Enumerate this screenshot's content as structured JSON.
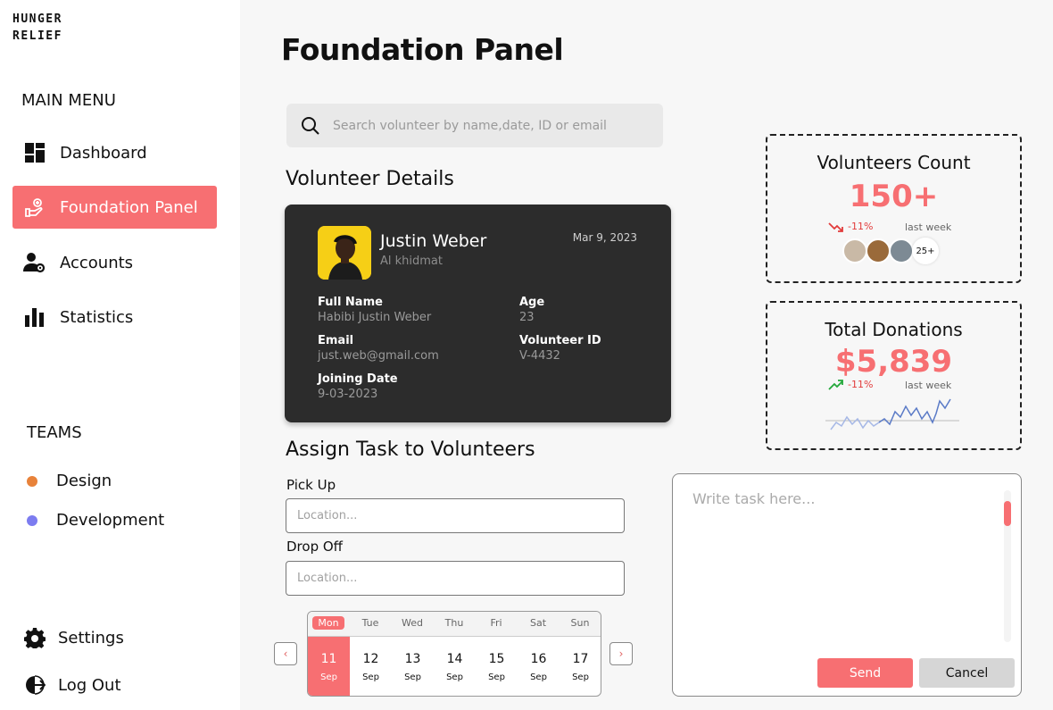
{
  "brand": {
    "line1": "HUNGER",
    "line2": "RELIEF"
  },
  "sidebar": {
    "main_menu_title": "MAIN MENU",
    "items": [
      {
        "label": "Dashboard",
        "icon": "dashboard-icon"
      },
      {
        "label": "Foundation Panel",
        "icon": "hand-heart-icon",
        "active": true
      },
      {
        "label": "Accounts",
        "icon": "user-gear-icon"
      },
      {
        "label": "Statistics",
        "icon": "bar-chart-icon"
      }
    ],
    "teams_title": "TEAMS",
    "teams": [
      {
        "label": "Design",
        "color": "#e8823a"
      },
      {
        "label": "Development",
        "color": "#7c7cf0"
      }
    ],
    "settings_label": "Settings",
    "logout_label": "Log Out"
  },
  "page": {
    "title": "Foundation Panel"
  },
  "search": {
    "placeholder": "Search volunteer by name,date, ID or email"
  },
  "volunteer": {
    "section_title": "Volunteer Details",
    "name": "Justin Weber",
    "org": "Al khidmat",
    "date": "Mar 9, 2023",
    "full_name_label": "Full Name",
    "full_name": "Habibi Justin Weber",
    "age_label": "Age",
    "age": "23",
    "email_label": "Email",
    "email": "just.web@gmail.com",
    "id_label": "Volunteer ID",
    "id": "V-4432",
    "joining_label": "Joining Date",
    "joining": "9-03-2023"
  },
  "stats": {
    "volunteers": {
      "title": "Volunteers Count",
      "value": "150+",
      "trend": "-11%",
      "trend_dir": "down",
      "period": "last week",
      "more": "25+"
    },
    "donations": {
      "title": "Total Donations",
      "value": "$5,839",
      "trend": "-11%",
      "trend_dir": "up",
      "period": "last week"
    }
  },
  "assign": {
    "title": "Assign Task to Volunteers",
    "pickup_label": "Pick Up",
    "pickup_placeholder": "Location...",
    "dropoff_label": "Drop Off",
    "dropoff_placeholder": "Location...",
    "task_placeholder": "Write task here...",
    "send_label": "Send",
    "cancel_label": "Cancel",
    "prev_arrow": "‹",
    "next_arrow": "›"
  },
  "calendar": {
    "days": [
      {
        "name": "Mon",
        "num": "11",
        "month": "Sep",
        "selected": true
      },
      {
        "name": "Tue",
        "num": "12",
        "month": "Sep"
      },
      {
        "name": "Wed",
        "num": "13",
        "month": "Sep"
      },
      {
        "name": "Thu",
        "num": "14",
        "month": "Sep"
      },
      {
        "name": "Fri",
        "num": "15",
        "month": "Sep"
      },
      {
        "name": "Sat",
        "num": "16",
        "month": "Sep"
      },
      {
        "name": "Sun",
        "num": "17",
        "month": "Sep"
      }
    ]
  },
  "colors": {
    "accent": "#f76f72",
    "card": "#2c2c2c",
    "trend_down": "#e23b3b",
    "trend_up": "#22a83a",
    "sparkline": "#5b7bc7"
  }
}
